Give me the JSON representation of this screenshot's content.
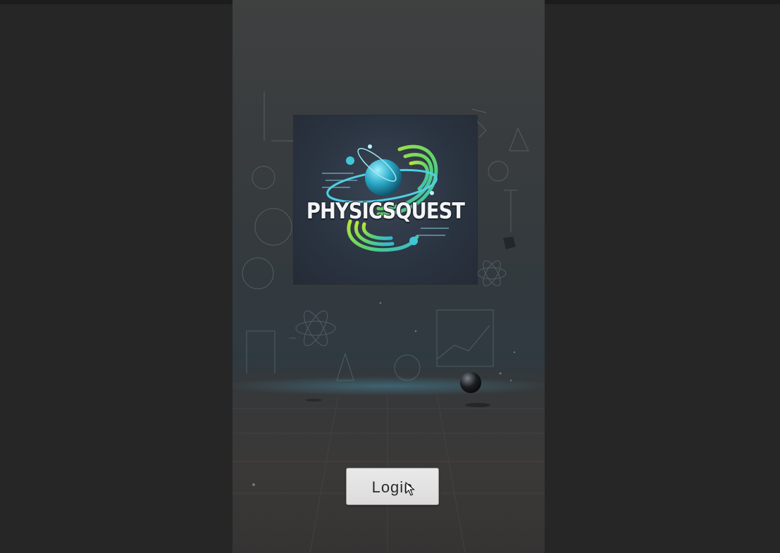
{
  "app": {
    "logo_text": "PHYSICSQUEST"
  },
  "actions": {
    "login_label": "Login"
  },
  "colors": {
    "outer_background": "#262626",
    "button_background": "#e2e2e2",
    "logo_accent_cyan": "#3fc6d8",
    "logo_accent_green": "#9ee03a"
  },
  "icons": {
    "logo": "physicsquest-logo-icon",
    "cursor": "mouse-pointer-icon"
  }
}
